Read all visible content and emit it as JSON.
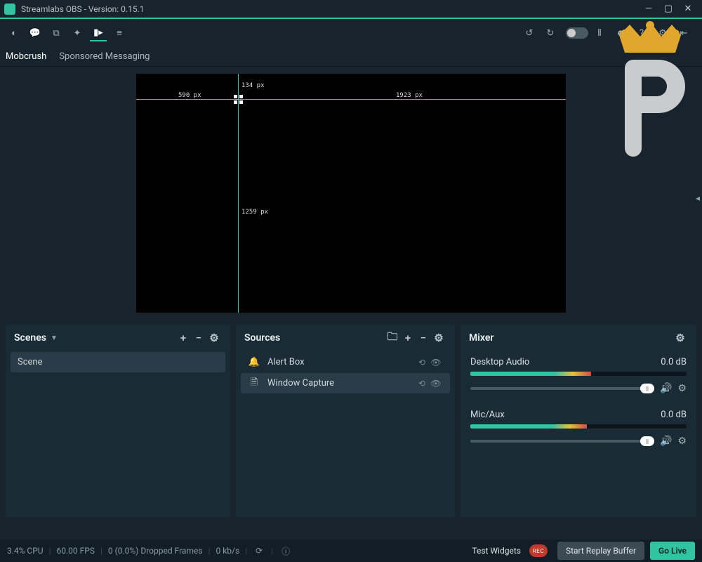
{
  "window": {
    "title": "Streamlabs OBS - Version: 0.15.1"
  },
  "tabs": {
    "mobcrush": "Mobcrush",
    "sponsored": "Sponsored Messaging"
  },
  "preview": {
    "left_px": "590 px",
    "top_px": "134 px",
    "right_px": "1923 px",
    "bottom_px": "1259 px"
  },
  "panels": {
    "scenes": {
      "title": "Scenes",
      "items": [
        {
          "label": "Scene"
        }
      ]
    },
    "sources": {
      "title": "Sources",
      "items": [
        {
          "icon": "bell",
          "label": "Alert Box",
          "selected": false
        },
        {
          "icon": "file",
          "label": "Window Capture",
          "selected": true
        }
      ]
    },
    "mixer": {
      "title": "Mixer",
      "channels": [
        {
          "name": "Desktop Audio",
          "db": "0.0 dB",
          "level": 56
        },
        {
          "name": "Mic/Aux",
          "db": "0.0 dB",
          "level": 54
        }
      ]
    }
  },
  "status": {
    "cpu": "3.4% CPU",
    "fps": "60.00 FPS",
    "dropped": "0 (0.0%) Dropped Frames",
    "bitrate": "0 kb/s",
    "rec": "REC",
    "test_widgets": "Test Widgets",
    "replay": "Start Replay Buffer",
    "golive": "Go Live"
  }
}
